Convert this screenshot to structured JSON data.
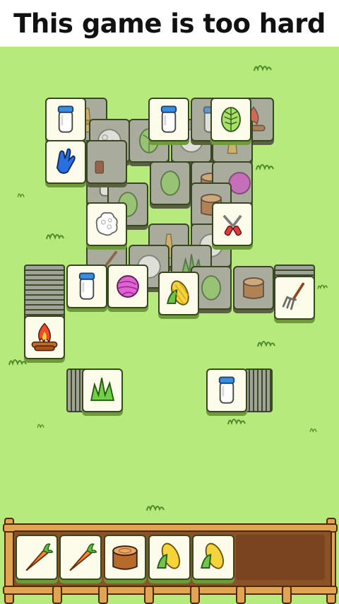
{
  "caption": {
    "title": "This game is too hard"
  },
  "colors": {
    "background": "#b7ea7c",
    "tile_face": "#fdfbe9",
    "tile_dim": "#a9ab9c",
    "tray_wood": "#8a5226"
  },
  "board": {
    "tiles_dimmed": [
      {
        "icon": "wheat-icon"
      },
      {
        "icon": "firewood-icon"
      },
      {
        "icon": "wool-icon"
      },
      {
        "icon": "cabbage-icon"
      },
      {
        "icon": "wool-icon"
      },
      {
        "icon": "wheat-icon"
      },
      {
        "icon": "milk-jar-icon"
      },
      {
        "icon": "cabbage-icon"
      },
      {
        "icon": "stump-icon"
      },
      {
        "icon": "yarn-icon"
      },
      {
        "icon": "cabbage-icon"
      },
      {
        "icon": "stump-icon"
      },
      {
        "icon": "wheat-icon"
      },
      {
        "icon": "wool-icon"
      },
      {
        "icon": "pitchfork-icon"
      },
      {
        "icon": "wool-icon"
      },
      {
        "icon": "grass-icon"
      },
      {
        "icon": "cabbage-icon"
      },
      {
        "icon": "stump-icon"
      },
      {
        "icon": "milk-jar-icon"
      },
      {
        "icon": "firewood-icon"
      }
    ],
    "tiles_open": [
      {
        "icon": "milk-jar-icon"
      },
      {
        "icon": "milk-jar-icon"
      },
      {
        "icon": "cabbage-icon"
      },
      {
        "icon": "glove-icon"
      },
      {
        "icon": "wool-icon"
      },
      {
        "icon": "shears-icon"
      },
      {
        "icon": "milk-jar-icon"
      },
      {
        "icon": "yarn-icon"
      },
      {
        "icon": "corn-icon"
      },
      {
        "icon": "pitchfork-icon"
      },
      {
        "icon": "firewood-icon"
      },
      {
        "icon": "grass-icon"
      },
      {
        "icon": "milk-jar-icon"
      }
    ]
  },
  "tray": {
    "capacity": 7,
    "slots": [
      {
        "icon": "carrot-icon"
      },
      {
        "icon": "carrot-icon"
      },
      {
        "icon": "stump-icon"
      },
      {
        "icon": "corn-icon"
      },
      {
        "icon": "corn-icon"
      }
    ]
  }
}
